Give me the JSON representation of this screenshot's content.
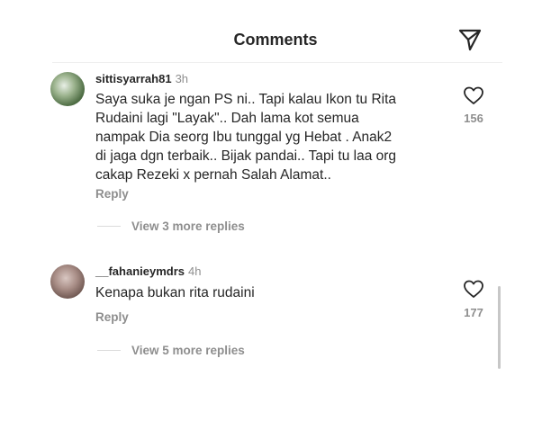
{
  "header": {
    "title": "Comments"
  },
  "comments": [
    {
      "username": "sittisyarrah81",
      "time": "3h",
      "text": "Saya suka je ngan PS ni.. Tapi kalau Ikon tu Rita\nRudaini lagi \"Layak\".. Dah lama kot semua\nnampak Dia seorg Ibu tunggal yg Hebat . Anak2\ndi jaga dgn terbaik.. Bijak pandai.. Tapi tu laa org\ncakap Rezeki x pernah Salah Alamat..",
      "reply_label": "Reply",
      "view_replies": "View 3 more replies",
      "likes": "156"
    },
    {
      "username": "__fahanieymdrs",
      "time": "4h",
      "text": "Kenapa bukan rita rudaini",
      "reply_label": "Reply",
      "view_replies": "View 5 more replies",
      "likes": "177"
    }
  ],
  "icons": {
    "share": "send-icon",
    "like": "heart-icon"
  },
  "colors": {
    "primary_text": "#262626",
    "secondary_text": "#8e8e8e"
  }
}
